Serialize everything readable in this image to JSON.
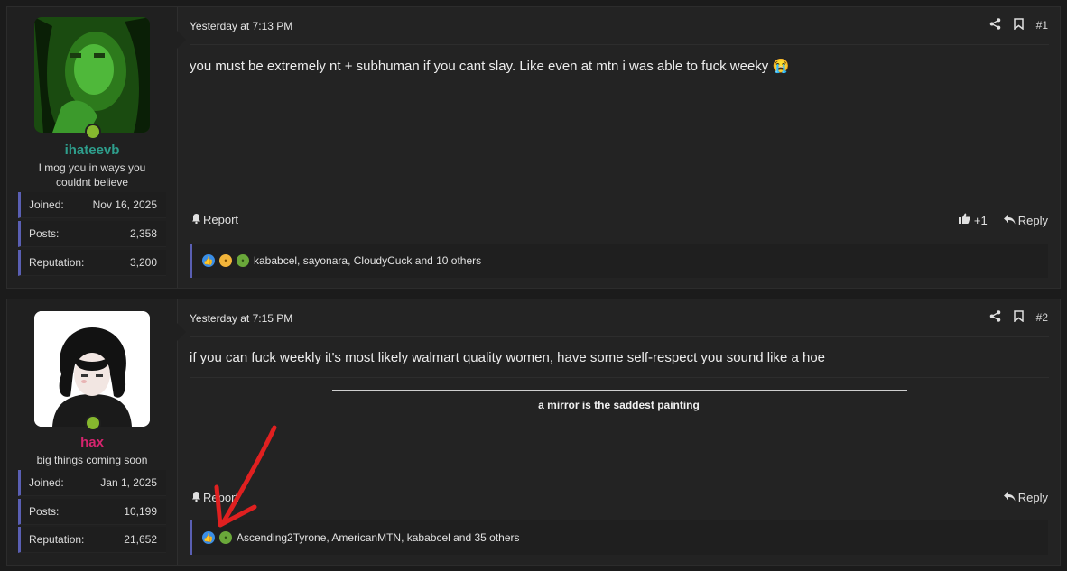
{
  "posts": [
    {
      "username": "ihateevb",
      "username_color": "#2e9e8c",
      "user_title": "I mog you in ways you couldnt believe",
      "stats": [
        {
          "label": "Joined:",
          "value": "Nov 16, 2025"
        },
        {
          "label": "Posts:",
          "value": "2,358"
        },
        {
          "label": "Reputation:",
          "value": "3,200"
        }
      ],
      "date": "Yesterday at 7:13 PM",
      "number": "#1",
      "message": "you must be extremely nt + subhuman if you cant slay. Like even at mtn i was able to fuck weeky 😭",
      "report_label": "Report",
      "like_count": "+1",
      "reply_label": "Reply",
      "reactions_text": "kababcel, sayonara, CloudyCuck and 10 others"
    },
    {
      "username": "hax",
      "username_color": "#d6246e",
      "user_title": "big things coming soon",
      "stats": [
        {
          "label": "Joined:",
          "value": "Jan 1, 2025"
        },
        {
          "label": "Posts:",
          "value": "10,199"
        },
        {
          "label": "Reputation:",
          "value": "21,652"
        }
      ],
      "date": "Yesterday at 7:15 PM",
      "number": "#2",
      "message": "if you can fuck weekly it's most likely walmart quality women, have some self-respect you sound like a hoe",
      "signature": "a mirror is the saddest painting",
      "report_label": "Report",
      "reply_label": "Reply",
      "reactions_text": "Ascending2Tyrone, AmericanMTN, kababcel and 35 others"
    }
  ],
  "icons": [
    "share-icon",
    "bookmark-icon",
    "bell-icon",
    "thumbs-up-icon",
    "reply-icon"
  ],
  "accent_color": "#5a5fb3",
  "online_color": "#86b82e"
}
